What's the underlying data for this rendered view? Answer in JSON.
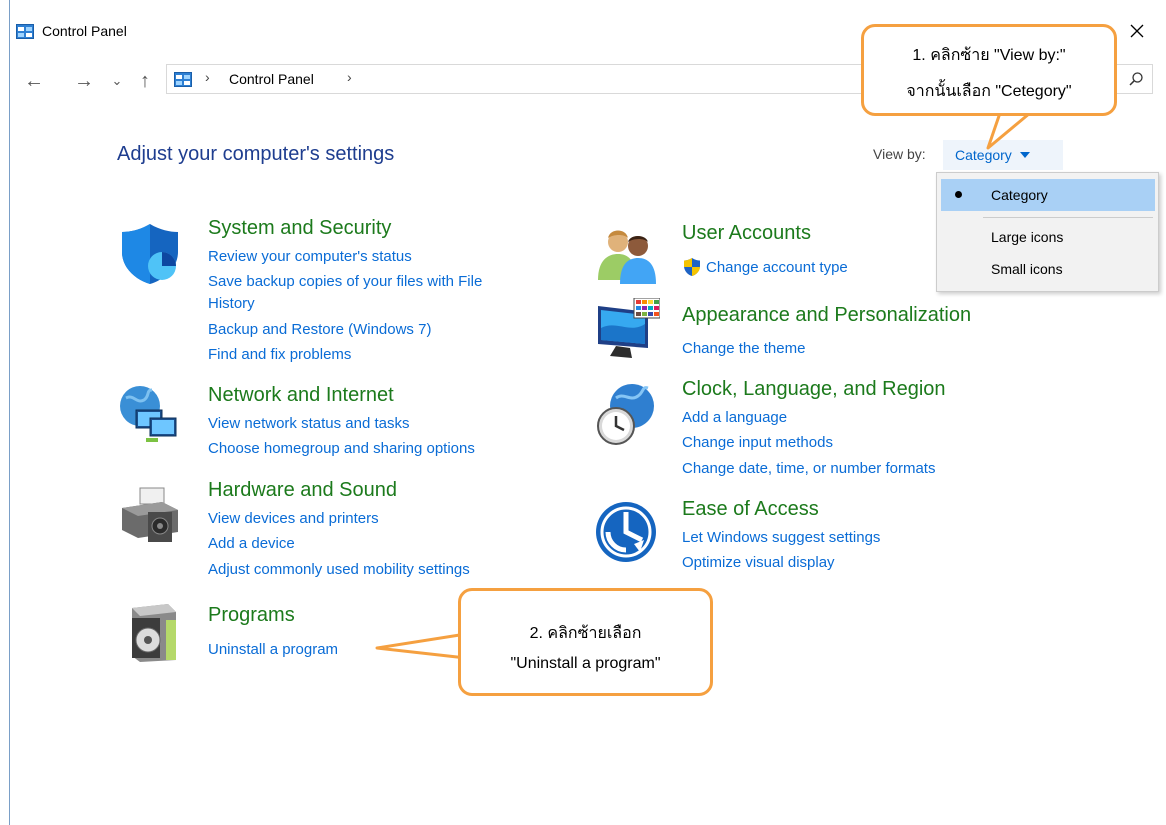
{
  "window": {
    "title": "Control Panel"
  },
  "address": {
    "path": "Control Panel",
    "separator": "›"
  },
  "nav": {
    "back": "←",
    "forward": "→",
    "recent": "⌄",
    "up": "↑"
  },
  "header": {
    "title": "Adjust your computer's settings",
    "view_by_label": "View by:",
    "view_by_value": "Category"
  },
  "view_menu": {
    "items": [
      {
        "label": "Category",
        "selected": true
      },
      {
        "label": "Large icons",
        "selected": false
      },
      {
        "label": "Small icons",
        "selected": false
      }
    ]
  },
  "categories_left": [
    {
      "title": "System and Security",
      "icon": "shield-icon",
      "links": [
        "Review your computer's status",
        "Save backup copies of your files with File",
        "History",
        "Backup and Restore (Windows 7)",
        "Find and fix problems"
      ]
    },
    {
      "title": "Network and Internet",
      "icon": "network-icon",
      "links": [
        "View network status and tasks",
        "Choose homegroup and sharing options"
      ]
    },
    {
      "title": "Hardware and Sound",
      "icon": "printer-icon",
      "links": [
        "View devices and printers",
        "Add a device",
        "Adjust commonly used mobility settings"
      ]
    },
    {
      "title": "Programs",
      "icon": "programs-icon",
      "links": [
        "Uninstall a program"
      ]
    }
  ],
  "categories_right": [
    {
      "title": "User Accounts",
      "icon": "users-icon",
      "links": [
        "Change account type"
      ]
    },
    {
      "title": "Appearance and Personalization",
      "icon": "monitor-icon",
      "links": [
        "Change the theme"
      ]
    },
    {
      "title": "Clock, Language, and Region",
      "icon": "clock-globe-icon",
      "links": [
        "Add a language",
        "Change input methods",
        "Change date, time, or number formats"
      ]
    },
    {
      "title": "Ease of Access",
      "icon": "ease-of-access-icon",
      "links": [
        "Let Windows suggest settings",
        "Optimize visual display"
      ]
    }
  ],
  "callouts": {
    "step1": {
      "line1": "1. คลิกซ้าย \"View by:\"",
      "line2": "จากนั้นเลือก \"Cetegory\""
    },
    "step2": {
      "line1": "2. คลิกซ้ายเลือก",
      "line2": "\"Uninstall a program\""
    }
  },
  "colors": {
    "title_green": "#1c7a1c",
    "link_blue": "#0a6cd6",
    "heading_blue": "#1e3d8f",
    "callout_orange": "#f5a040",
    "menu_highlight": "#a9d0f5"
  }
}
